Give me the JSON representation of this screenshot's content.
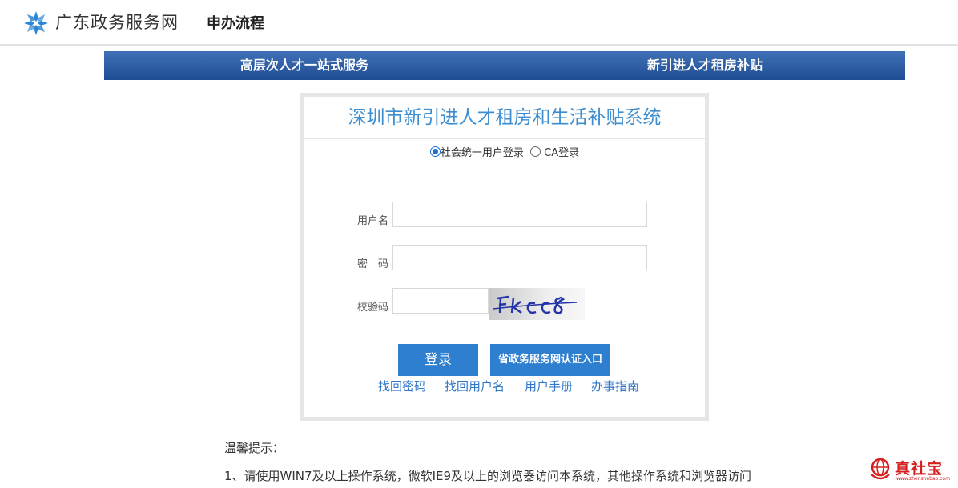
{
  "header": {
    "site_name": "广东政务服务网",
    "page_title": "申办流程",
    "logo_icon": "snowflake-logo-icon",
    "logo_color": "#2c86d6"
  },
  "nav": {
    "items": [
      {
        "label": "高层次人才一站式服务"
      },
      {
        "label": "新引进人才租房补贴"
      }
    ],
    "bg_color": "#2a5aa3"
  },
  "login": {
    "system_title": "深圳市新引进人才租房和生活补贴系统",
    "modes": [
      {
        "label": "社会统一用户登录",
        "selected": true
      },
      {
        "label": "CA登录",
        "selected": false
      }
    ],
    "fields": {
      "username_label": "用户名",
      "username_value": "",
      "password_label": "密　码",
      "password_value": "",
      "captcha_label": "校验码",
      "captcha_value": "",
      "captcha_image_text": "Fkcc8"
    },
    "login_button": "登录",
    "gov_button": "省政务服务网认证入口",
    "links": [
      "找回密码",
      "找回用户名",
      "用户手册",
      "办事指南"
    ],
    "accent_color": "#2f7fd1"
  },
  "tips": {
    "title": "温馨提示：",
    "lines": [
      "1、请使用WIN7及以上操作系统，微软IE9及以上的浏览器访问本系统，其他操作系统和浏览器访问"
    ]
  },
  "watermark": {
    "text": "真社宝",
    "sub": "www.zhenshebao.com"
  }
}
